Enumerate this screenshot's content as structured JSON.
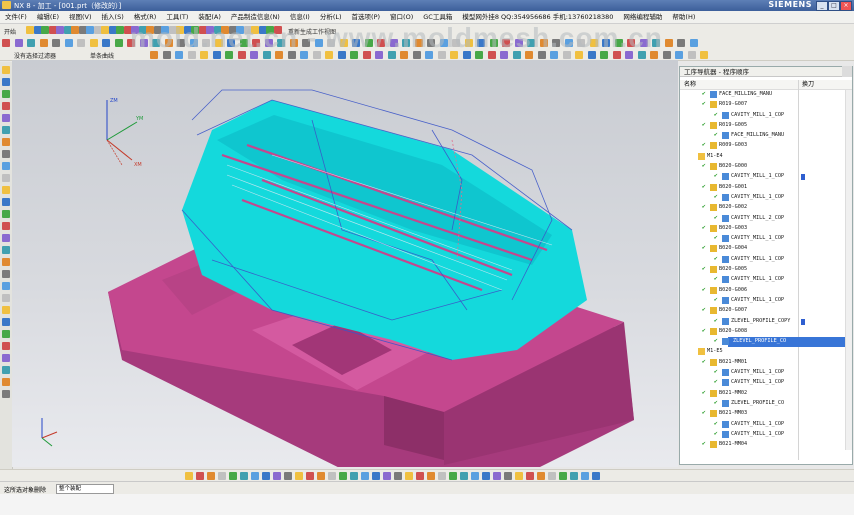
{
  "window": {
    "title": "NX 8 - 加工 - [001.prt（修改的）]",
    "brand": "SIEMENS",
    "controls": [
      "_",
      "□",
      "×"
    ]
  },
  "menu": [
    "文件(F)",
    "编辑(E)",
    "视图(V)",
    "插入(S)",
    "格式(R)",
    "工具(T)",
    "装配(A)",
    "产品制造信息(N)",
    "信息(I)",
    "分析(L)",
    "首选项(P)",
    "窗口(O)",
    "GC工具箱",
    "模型网外挂8 QQ:354956686 手机:13760218380",
    "网络编程辅助",
    "帮助(H)"
  ],
  "toolbar": {
    "mode_label": "开始",
    "selection_filter": "没有选择过滤器",
    "assembly_filter": "整个装配",
    "scope_label": "单条曲线",
    "display_label": "重新生成工作视图"
  },
  "watermark": "mold.net.cn - www.moldmesh.com.cn",
  "navigator": {
    "title": "工序导航器 - 程序顺序",
    "columns": [
      "名称",
      "换刀"
    ],
    "rows": [
      {
        "indent": 0,
        "kind": "op",
        "label": "FACE_MILLING_MANU",
        "selected": false,
        "toolbar": false
      },
      {
        "indent": 0,
        "kind": "group",
        "label": "R019-G007",
        "selected": false,
        "toolbar": false
      },
      {
        "indent": 1,
        "kind": "op",
        "label": "CAVITY_MILL_1_COP",
        "selected": false,
        "toolbar": false
      },
      {
        "indent": 0,
        "kind": "group",
        "label": "R019-G005",
        "selected": false,
        "toolbar": false
      },
      {
        "indent": 1,
        "kind": "op",
        "label": "FACE_MILLING_MANU",
        "selected": false,
        "toolbar": false
      },
      {
        "indent": 0,
        "kind": "group",
        "label": "R009-G003",
        "selected": false,
        "toolbar": false
      },
      {
        "indent": -1,
        "kind": "root",
        "label": "M1-E4",
        "selected": false,
        "toolbar": false
      },
      {
        "indent": 0,
        "kind": "group",
        "label": "B020-G000",
        "selected": false,
        "toolbar": false
      },
      {
        "indent": 1,
        "kind": "op",
        "label": "CAVITY_MILL_1_COP",
        "selected": false,
        "toolbar": true
      },
      {
        "indent": 0,
        "kind": "group",
        "label": "B020-G001",
        "selected": false,
        "toolbar": false
      },
      {
        "indent": 1,
        "kind": "op",
        "label": "CAVITY_MILL_1_COP",
        "selected": false,
        "toolbar": false
      },
      {
        "indent": 0,
        "kind": "group",
        "label": "B020-G002",
        "selected": false,
        "toolbar": false
      },
      {
        "indent": 1,
        "kind": "op",
        "label": "CAVITY_MILL_2_COP",
        "selected": false,
        "toolbar": false
      },
      {
        "indent": 0,
        "kind": "group",
        "label": "B020-G003",
        "selected": false,
        "toolbar": false
      },
      {
        "indent": 1,
        "kind": "op",
        "label": "CAVITY_MILL_1_COP",
        "selected": false,
        "toolbar": false
      },
      {
        "indent": 0,
        "kind": "group",
        "label": "B020-G004",
        "selected": false,
        "toolbar": false
      },
      {
        "indent": 1,
        "kind": "op",
        "label": "CAVITY_MILL_1_COP",
        "selected": false,
        "toolbar": false
      },
      {
        "indent": 0,
        "kind": "group",
        "label": "B020-G005",
        "selected": false,
        "toolbar": false
      },
      {
        "indent": 1,
        "kind": "op",
        "label": "CAVITY_MILL_1_COP",
        "selected": false,
        "toolbar": false
      },
      {
        "indent": 0,
        "kind": "group",
        "label": "B020-G006",
        "selected": false,
        "toolbar": false
      },
      {
        "indent": 1,
        "kind": "op",
        "label": "CAVITY_MILL_1_COP",
        "selected": false,
        "toolbar": false
      },
      {
        "indent": 0,
        "kind": "group",
        "label": "B020-G007",
        "selected": false,
        "toolbar": false
      },
      {
        "indent": 1,
        "kind": "op",
        "label": "ZLEVEL_PROFILE_COPY",
        "selected": false,
        "toolbar": true
      },
      {
        "indent": 0,
        "kind": "group",
        "label": "B020-G008",
        "selected": false,
        "toolbar": false
      },
      {
        "indent": 1,
        "kind": "op",
        "label": "ZLEVEL_PROFILE_CO",
        "selected": true,
        "toolbar": false
      },
      {
        "indent": -1,
        "kind": "root",
        "label": "M1-E5",
        "selected": false,
        "toolbar": false
      },
      {
        "indent": 0,
        "kind": "group",
        "label": "B021-MM01",
        "selected": false,
        "toolbar": false
      },
      {
        "indent": 1,
        "kind": "op",
        "label": "CAVITY_MILL_1_COP",
        "selected": false,
        "toolbar": false
      },
      {
        "indent": 1,
        "kind": "op",
        "label": "CAVITY_MILL_1_COP",
        "selected": false,
        "toolbar": false
      },
      {
        "indent": 0,
        "kind": "group",
        "label": "B021-MM02",
        "selected": false,
        "toolbar": false
      },
      {
        "indent": 1,
        "kind": "op",
        "label": "ZLEVEL_PROFILE_CO",
        "selected": false,
        "toolbar": false
      },
      {
        "indent": 0,
        "kind": "group",
        "label": "B021-MM03",
        "selected": false,
        "toolbar": false
      },
      {
        "indent": 1,
        "kind": "op",
        "label": "CAVITY_MILL_1_COP",
        "selected": false,
        "toolbar": false
      },
      {
        "indent": 1,
        "kind": "op",
        "label": "CAVITY_MILL_1_COP",
        "selected": false,
        "toolbar": false
      },
      {
        "indent": 0,
        "kind": "group",
        "label": "B021-MM04",
        "selected": false,
        "toolbar": false
      }
    ]
  },
  "status": {
    "left": "这所选对象删除",
    "filter": "整个装配"
  },
  "axes": {
    "zm": "ZM",
    "xm": "XM",
    "ym": "YM"
  },
  "colors": {
    "part": "#b0387f",
    "toolpath": "#00e5e5",
    "toolpath_alt": "#3b55c8",
    "selection": "#3875d7",
    "title_bar": "#3c5f9a"
  }
}
